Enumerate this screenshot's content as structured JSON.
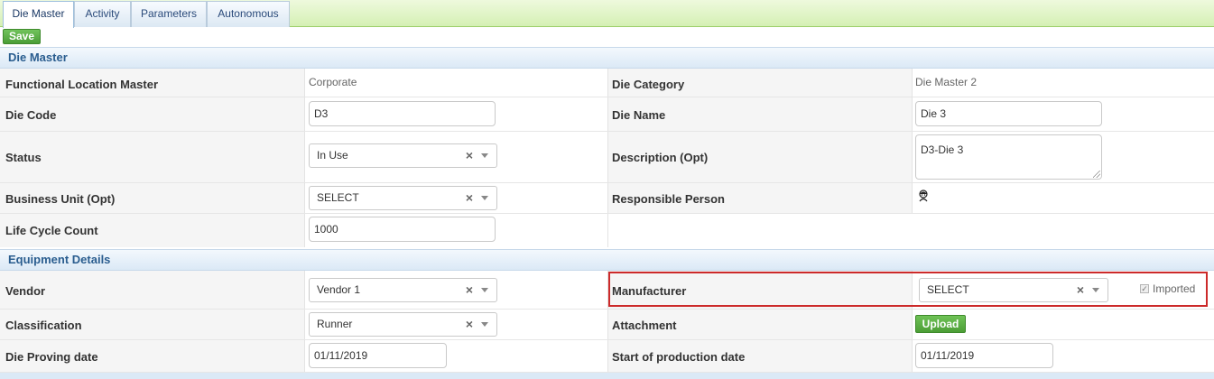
{
  "tabs": [
    {
      "label": "Die Master",
      "active": true
    },
    {
      "label": "Activity",
      "active": false
    },
    {
      "label": "Parameters",
      "active": false
    },
    {
      "label": "Autonomous",
      "active": false
    }
  ],
  "toolbar": {
    "save_label": "Save"
  },
  "sections": {
    "die_master": "Die Master",
    "equipment_details": "Equipment Details"
  },
  "form": {
    "functional_location": {
      "label": "Functional Location Master",
      "value": "Corporate"
    },
    "die_category": {
      "label": "Die Category",
      "value": "Die Master 2"
    },
    "die_code": {
      "label": "Die Code",
      "value": "D3"
    },
    "die_name": {
      "label": "Die Name",
      "value": "Die 3"
    },
    "status": {
      "label": "Status",
      "value": "In Use"
    },
    "description": {
      "label": "Description (Opt)",
      "value": "D3-Die 3"
    },
    "business_unit": {
      "label": "Business Unit (Opt)",
      "value": "SELECT"
    },
    "responsible_person": {
      "label": "Responsible Person"
    },
    "life_cycle_count": {
      "label": "Life Cycle Count",
      "value": "1000"
    },
    "vendor": {
      "label": "Vendor",
      "value": "Vendor 1"
    },
    "manufacturer": {
      "label": "Manufacturer",
      "value": "SELECT",
      "imported_label": "Imported",
      "imported_checked": true
    },
    "classification": {
      "label": "Classification",
      "value": "Runner"
    },
    "attachment": {
      "label": "Attachment",
      "upload_label": "Upload"
    },
    "die_proving_date": {
      "label": "Die Proving date",
      "value": "01/11/2019"
    },
    "start_production_date": {
      "label": "Start of production date",
      "value": "01/11/2019"
    }
  },
  "icons": {
    "clear": "×",
    "checkmark": "✓"
  },
  "colors": {
    "accent_green": "#4a9d36",
    "section_text": "#2a5d8f",
    "highlight_red": "#cc2a2a"
  }
}
